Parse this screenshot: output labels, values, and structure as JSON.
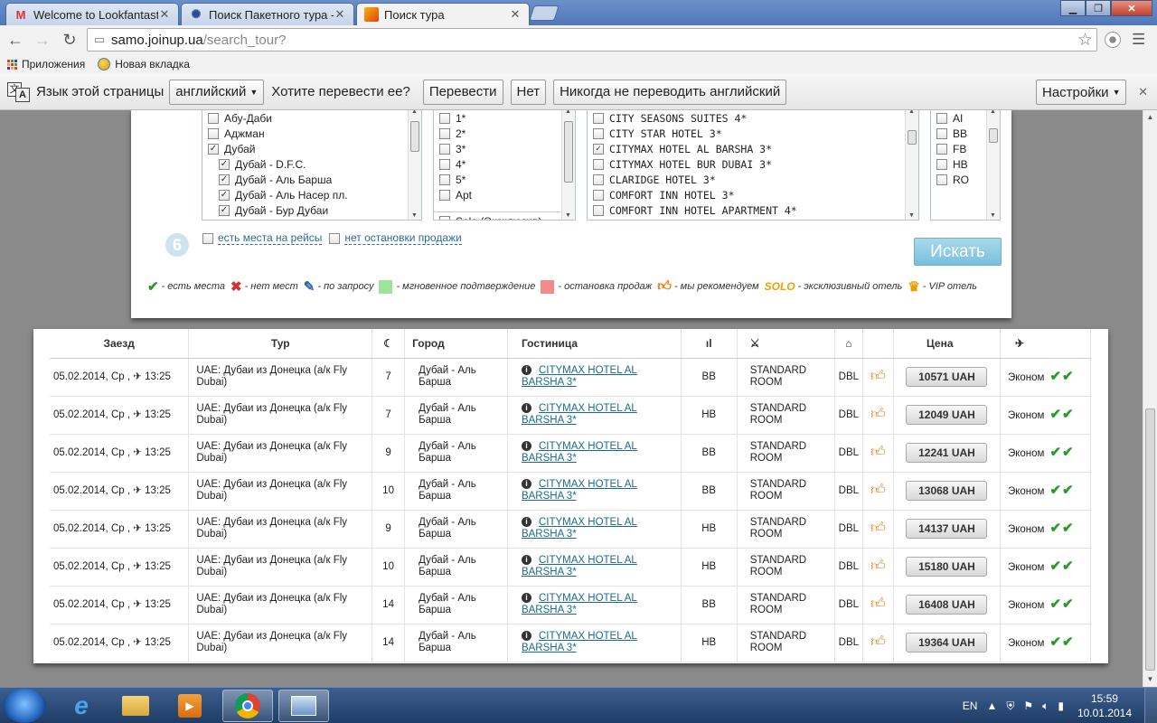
{
  "browser": {
    "tabs": [
      {
        "title": "Welcome to Lookfantastic",
        "icon": "gmail-icon",
        "active": false
      },
      {
        "title": "Поиск Пакетного тура - J",
        "icon": "joinup-icon",
        "active": false
      },
      {
        "title": "Поиск тура",
        "icon": "joinup-orange-icon",
        "active": true
      }
    ],
    "address": {
      "host": "samo.joinup.ua",
      "path": "/search_tour?"
    },
    "bookmarks": [
      {
        "label": "Приложения",
        "icon": "apps-icon"
      },
      {
        "label": "Новая вкладка",
        "icon": "globe-icon"
      }
    ],
    "translate": {
      "prompt": "Язык этой страницы",
      "language": "английский",
      "question": "Хотите перевести ее?",
      "translate_btn": "Перевести",
      "no_btn": "Нет",
      "never_btn": "Никогда не переводить английский",
      "settings_btn": "Настройки"
    }
  },
  "search": {
    "cities": [
      {
        "label": "Абу-Даби",
        "checked": false,
        "indent": false
      },
      {
        "label": "Аджман",
        "checked": false,
        "indent": false
      },
      {
        "label": "Дубай",
        "checked": true,
        "indent": false
      },
      {
        "label": "Дубай - D.F.C.",
        "checked": true,
        "indent": true
      },
      {
        "label": "Дубай - Аль Барша",
        "checked": true,
        "indent": true
      },
      {
        "label": "Дубай - Аль Насер пл.",
        "checked": true,
        "indent": true
      },
      {
        "label": "Дубай - Бур Дубаи",
        "checked": true,
        "indent": true
      }
    ],
    "stars": [
      {
        "label": "1*",
        "checked": false
      },
      {
        "label": "2*",
        "checked": false
      },
      {
        "label": "3*",
        "checked": false
      },
      {
        "label": "4*",
        "checked": false
      },
      {
        "label": "5*",
        "checked": false
      },
      {
        "label": "Apt",
        "checked": false
      },
      {
        "label": "Solo (Эксклюзив)",
        "checked": false
      }
    ],
    "hotels": [
      {
        "label": "CITY SEASONS SUITES 4*",
        "checked": false
      },
      {
        "label": "CITY STAR HOTEL 3*",
        "checked": false
      },
      {
        "label": "CITYMAX HOTEL AL BARSHA 3*",
        "checked": true
      },
      {
        "label": "CITYMAX HOTEL BUR DUBAI 3*",
        "checked": false
      },
      {
        "label": "CLARIDGE HOTEL 3*",
        "checked": false
      },
      {
        "label": "COMFORT INN HOTEL 3*",
        "checked": false
      },
      {
        "label": "COMFORT INN HOTEL APARTMENT 4*",
        "checked": false
      }
    ],
    "meals": [
      {
        "label": "AI",
        "checked": false
      },
      {
        "label": "BB",
        "checked": false
      },
      {
        "label": "FB",
        "checked": false
      },
      {
        "label": "HB",
        "checked": false
      },
      {
        "label": "RO",
        "checked": false
      }
    ],
    "step_number": "6",
    "filter_seats": "есть места на рейсы",
    "filter_nostop": "нет остановки продажи",
    "search_btn": "Искать",
    "legend": {
      "available": "- есть места",
      "none": "- нет мест",
      "request": "- по запросу",
      "instant": "- мгновенное подтверждение",
      "stop": "- остановка продаж",
      "recommend": "- мы рекомендуем",
      "solo_word": "SOLO",
      "solo": "- эксклюзивный отель",
      "vip": "- VIP отель",
      "instant_color": "#9de39a",
      "stop_color": "#f28b8b"
    }
  },
  "results": {
    "headers": {
      "checkin": "Заезд",
      "tour": "Тур",
      "nights_icon": "moon-icon",
      "city": "Город",
      "hotel": "Гостиница",
      "meal_icon": "cutlery-icon",
      "room_icon": "bed-icon",
      "accom_icon": "home-icon",
      "price": "Цена",
      "flight_icon": "plane-icon"
    },
    "rows": [
      {
        "date": "05.02.2014, Ср ,",
        "time": "13:25",
        "tour": "UAE: Дубаи из Донецка (а/к Fly Dubai)",
        "nights": "7",
        "city": "Дубай - Аль Барша",
        "hotel": "CITYMAX HOTEL AL BARSHA 3*",
        "meal": "BB",
        "room": "STANDARD ROOM",
        "accom": "DBL",
        "price": "10571 UAH",
        "flight": "Эконом"
      },
      {
        "date": "05.02.2014, Ср ,",
        "time": "13:25",
        "tour": "UAE: Дубаи из Донецка (а/к Fly Dubai)",
        "nights": "7",
        "city": "Дубай - Аль Барша",
        "hotel": "CITYMAX HOTEL AL BARSHA 3*",
        "meal": "HB",
        "room": "STANDARD ROOM",
        "accom": "DBL",
        "price": "12049 UAH",
        "flight": "Эконом"
      },
      {
        "date": "05.02.2014, Ср ,",
        "time": "13:25",
        "tour": "UAE: Дубаи из Донецка (а/к Fly Dubai)",
        "nights": "9",
        "city": "Дубай - Аль Барша",
        "hotel": "CITYMAX HOTEL AL BARSHA 3*",
        "meal": "BB",
        "room": "STANDARD ROOM",
        "accom": "DBL",
        "price": "12241 UAH",
        "flight": "Эконом"
      },
      {
        "date": "05.02.2014, Ср ,",
        "time": "13:25",
        "tour": "UAE: Дубаи из Донецка (а/к Fly Dubai)",
        "nights": "10",
        "city": "Дубай - Аль Барша",
        "hotel": "CITYMAX HOTEL AL BARSHA 3*",
        "meal": "BB",
        "room": "STANDARD ROOM",
        "accom": "DBL",
        "price": "13068 UAH",
        "flight": "Эконом"
      },
      {
        "date": "05.02.2014, Ср ,",
        "time": "13:25",
        "tour": "UAE: Дубаи из Донецка (а/к Fly Dubai)",
        "nights": "9",
        "city": "Дубай - Аль Барша",
        "hotel": "CITYMAX HOTEL AL BARSHA 3*",
        "meal": "HB",
        "room": "STANDARD ROOM",
        "accom": "DBL",
        "price": "14137 UAH",
        "flight": "Эконом"
      },
      {
        "date": "05.02.2014, Ср ,",
        "time": "13:25",
        "tour": "UAE: Дубаи из Донецка (а/к Fly Dubai)",
        "nights": "10",
        "city": "Дубай - Аль Барша",
        "hotel": "CITYMAX HOTEL AL BARSHA 3*",
        "meal": "HB",
        "room": "STANDARD ROOM",
        "accom": "DBL",
        "price": "15180 UAH",
        "flight": "Эконом"
      },
      {
        "date": "05.02.2014, Ср ,",
        "time": "13:25",
        "tour": "UAE: Дубаи из Донецка (а/к Fly Dubai)",
        "nights": "14",
        "city": "Дубай - Аль Барша",
        "hotel": "CITYMAX HOTEL AL BARSHA 3*",
        "meal": "BB",
        "room": "STANDARD ROOM",
        "accom": "DBL",
        "price": "16408 UAH",
        "flight": "Эконом"
      },
      {
        "date": "05.02.2014, Ср ,",
        "time": "13:25",
        "tour": "UAE: Дубаи из Донецка (а/к Fly Dubai)",
        "nights": "14",
        "city": "Дубай - Аль Барша",
        "hotel": "CITYMAX HOTEL AL BARSHA 3*",
        "meal": "HB",
        "room": "STANDARD ROOM",
        "accom": "DBL",
        "price": "19364 UAH",
        "flight": "Эконом"
      }
    ]
  },
  "taskbar": {
    "apps": [
      {
        "icon": "ie-icon"
      },
      {
        "icon": "explorer-icon"
      },
      {
        "icon": "media-player-icon"
      },
      {
        "icon": "chrome-icon",
        "active": true
      },
      {
        "icon": "remote-desktop-icon",
        "active": true
      }
    ],
    "lang": "EN",
    "time": "15:59",
    "date": "10.01.2014"
  }
}
